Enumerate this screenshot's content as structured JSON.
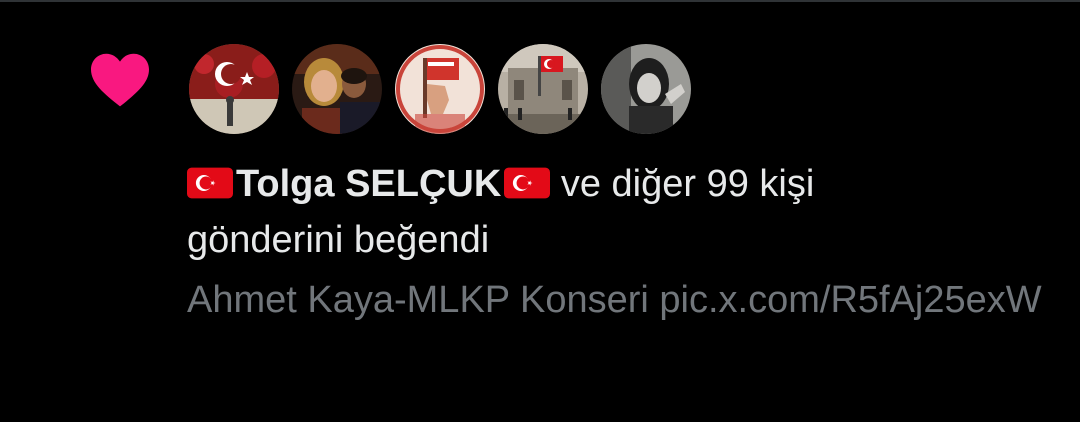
{
  "notification": {
    "icon": "heart-icon",
    "icon_color": "#f91880",
    "avatars": [
      {
        "name": "avatar-flag-display"
      },
      {
        "name": "avatar-couple"
      },
      {
        "name": "avatar-hand-flag"
      },
      {
        "name": "avatar-building-flag"
      },
      {
        "name": "avatar-bw-woman"
      }
    ],
    "liker_flag_before": "turkey-flag-icon",
    "liker_name": "Tolga SELÇUK",
    "liker_flag_after": "turkey-flag-icon",
    "rest_line1": " ve diğer 99 kişi",
    "rest_line2": "gönderini beğendi",
    "post_text": "Ahmet Kaya-MLKP Konseri ",
    "post_link": "pic.x.com/R5fAj25exW"
  },
  "colors": {
    "background": "#000000",
    "primary_text": "#e7e9ea",
    "secondary_text": "#71767b",
    "flag_red": "#e30a17"
  }
}
